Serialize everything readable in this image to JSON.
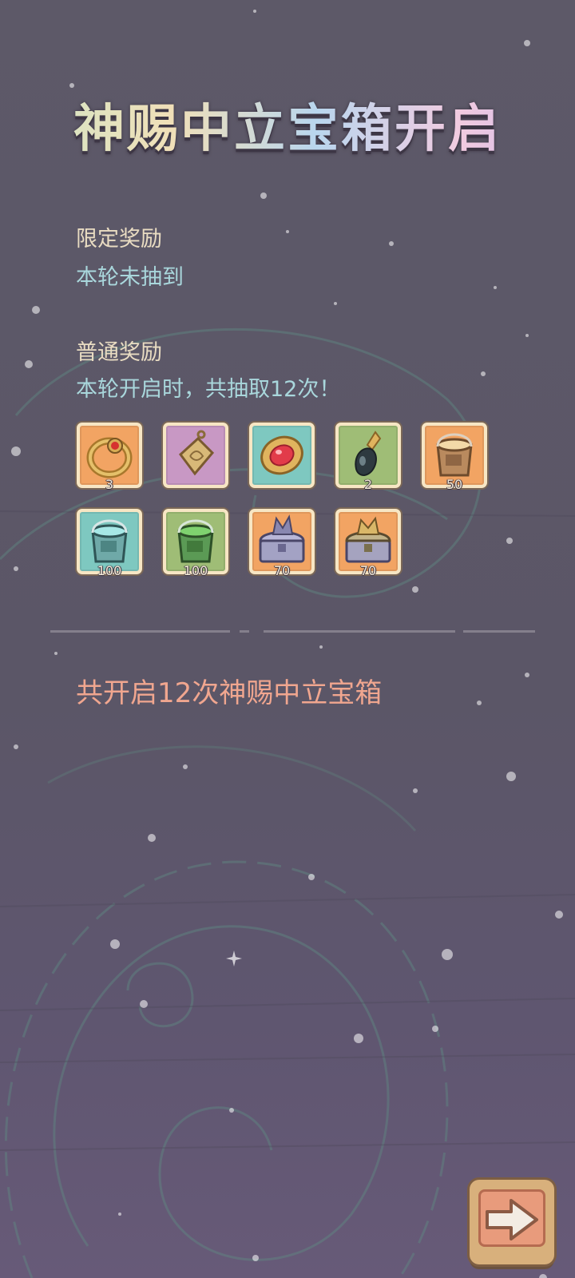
{
  "title": "神赐中立宝箱开启",
  "limited": {
    "heading": "限定奖励",
    "status": "本轮未抽到"
  },
  "normal": {
    "heading": "普通奖励",
    "status": "本轮开启时，共抽取12次！"
  },
  "rewards": [
    {
      "icon": "ring-icon",
      "bg": "#f2a463",
      "qty": "3"
    },
    {
      "icon": "amulet-pendant-icon",
      "bg": "#c898c4",
      "qty": ""
    },
    {
      "icon": "ruby-brooch-icon",
      "bg": "#7ec8c0",
      "qty": ""
    },
    {
      "icon": "black-pearl-pendant-icon",
      "bg": "#9fbd76",
      "qty": "2"
    },
    {
      "icon": "orange-paint-bucket-icon",
      "bg": "#f2a463",
      "qty": "50"
    },
    {
      "icon": "cyan-paint-bucket-icon",
      "bg": "#7ec8c0",
      "qty": "100"
    },
    {
      "icon": "green-paint-bucket-icon",
      "bg": "#9fbd76",
      "qty": "100"
    },
    {
      "icon": "silver-dragon-chest-icon",
      "bg": "#f2a463",
      "qty": "70"
    },
    {
      "icon": "gold-dragon-chest-icon",
      "bg": "#f2a463",
      "qty": "70"
    }
  ],
  "summary": "共开启12次神赐中立宝箱",
  "next_button": {
    "icon": "arrow-right-icon"
  }
}
